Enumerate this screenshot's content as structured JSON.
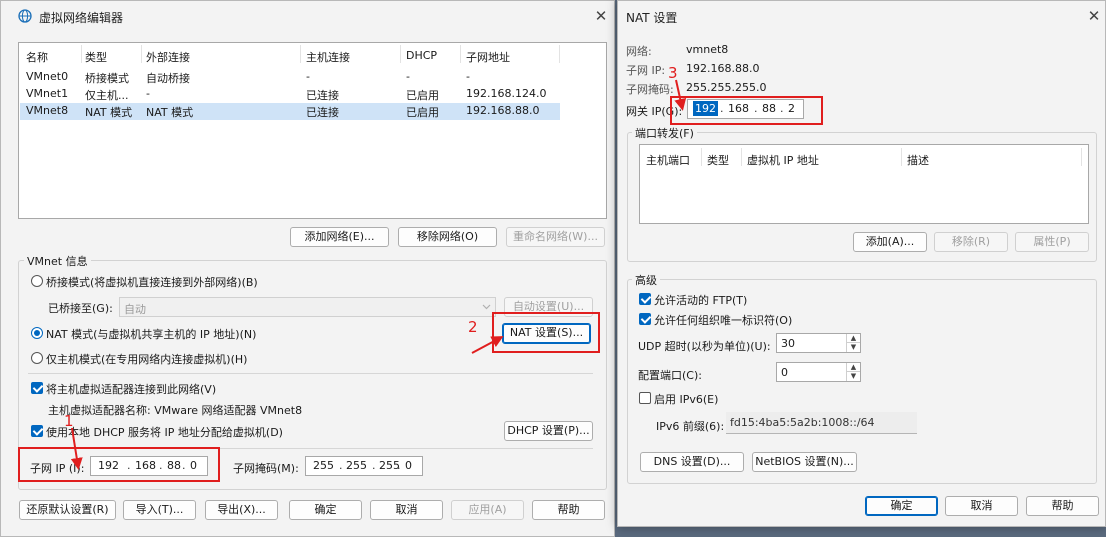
{
  "vne": {
    "title": "虚拟网络编辑器",
    "close_glyph": "✕",
    "table": {
      "headers": [
        "名称",
        "类型",
        "外部连接",
        "主机连接",
        "DHCP",
        "子网地址"
      ],
      "rows": [
        [
          "VMnet0",
          "桥接模式",
          "自动桥接",
          "-",
          "-",
          "-"
        ],
        [
          "VMnet1",
          "仅主机...",
          "-",
          "已连接",
          "已启用",
          "192.168.124.0"
        ],
        [
          "VMnet8",
          "NAT 模式",
          "NAT 模式",
          "已连接",
          "已启用",
          "192.168.88.0"
        ]
      ]
    },
    "buttons": {
      "add_network": "添加网络(E)...",
      "remove_network": "移除网络(O)",
      "rename_network": "重命名网络(W)..."
    },
    "vmnet_info": "VMnet 信息",
    "bridge_mode": "桥接模式(将虚拟机直接连接到外部网络)(B)",
    "bridged_to_label": "已桥接至(G):",
    "bridged_to_value": "自动",
    "auto_settings": "自动设置(U)...",
    "nat_mode": "NAT 模式(与虚拟机共享主机的 IP 地址)(N)",
    "nat_settings": "NAT 设置(S)...",
    "host_only": "仅主机模式(在专用网络内连接虚拟机)(H)",
    "connect_adapter": "将主机虚拟适配器连接到此网络(V)",
    "adapter_name": "主机虚拟适配器名称: VMware 网络适配器 VMnet8",
    "use_dhcp": "使用本地 DHCP 服务将 IP 地址分配给虚拟机(D)",
    "dhcp_settings": "DHCP 设置(P)...",
    "subnet_ip_label": "子网 IP (I):",
    "subnet_ip": [
      "192",
      "168",
      "88",
      "0"
    ],
    "subnet_mask_label": "子网掩码(M):",
    "subnet_mask": [
      "255",
      "255",
      "255",
      "0"
    ],
    "bottom": {
      "restore": "还原默认设置(R)",
      "import": "导入(T)...",
      "export": "导出(X)...",
      "ok": "确定",
      "cancel": "取消",
      "apply": "应用(A)",
      "help": "帮助"
    }
  },
  "nat": {
    "title": "NAT 设置",
    "close_glyph": "✕",
    "network_label": "网络:",
    "network_value": "vmnet8",
    "subnet_ip_label": "子网 IP:",
    "subnet_ip_value": "192.168.88.0",
    "subnet_mask_label": "子网掩码:",
    "subnet_mask_value": "255.255.255.0",
    "gateway_label": "网关 IP(G):",
    "gateway_ip": [
      "192",
      "168",
      "88",
      "2"
    ],
    "port_forwarding": "端口转发(F)",
    "pf_headers": [
      "主机端口",
      "类型",
      "虚拟机 IP 地址",
      "描述"
    ],
    "pf_add": "添加(A)...",
    "pf_remove": "移除(R)",
    "pf_props": "属性(P)",
    "advanced": "高级",
    "allow_ftp": "允许活动的 FTP(T)",
    "allow_oui": "允许任何组织唯一标识符(O)",
    "udp_timeout_label": "UDP 超时(以秒为单位)(U):",
    "udp_timeout": "30",
    "config_port_label": "配置端口(C):",
    "config_port": "0",
    "enable_ipv6": "启用 IPv6(E)",
    "ipv6_prefix_label": "IPv6 前缀(6):",
    "ipv6_prefix": "fd15:4ba5:5a2b:1008::/64",
    "dns_settings": "DNS 设置(D)...",
    "netbios_settings": "NetBIOS 设置(N)...",
    "ok": "确定",
    "cancel": "取消",
    "help": "帮助"
  },
  "annotations": [
    "1",
    "2",
    "3"
  ],
  "colors": {
    "accent": "#0067c0",
    "annotation": "#e01e1e",
    "selection": "#cfe3f7"
  }
}
